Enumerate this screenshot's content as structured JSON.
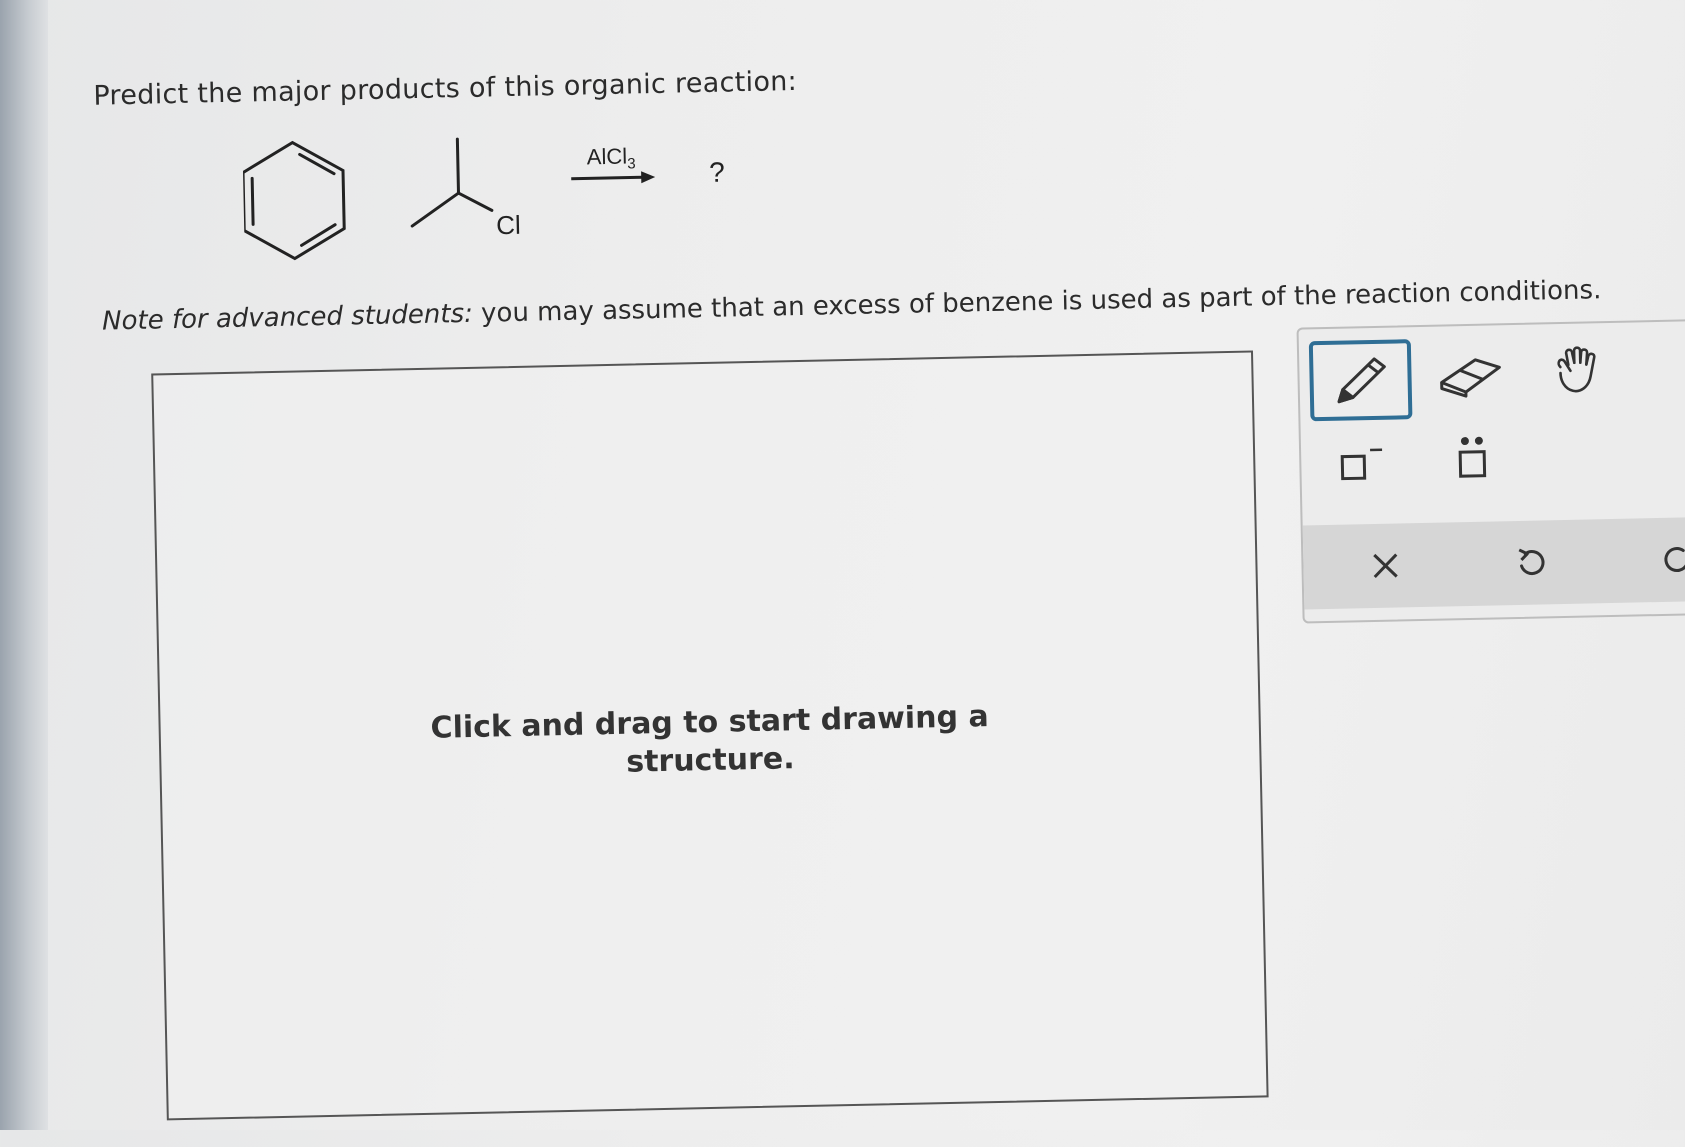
{
  "question": {
    "prompt": "Predict the major products of this organic reaction:",
    "note_italic": "Note for advanced students:",
    "note_rest": " you may assume that an excess of benzene is used as part of the reaction conditions."
  },
  "reaction": {
    "halide_atom": "Cl",
    "reagent": "AlCl",
    "reagent_subscript": "3",
    "product": "?"
  },
  "drawing_canvas": {
    "hint_line1": "Click and drag to start drawing a",
    "hint_line2": "structure."
  },
  "toolbox": {
    "tools": [
      "pencil-icon",
      "eraser-icon",
      "hand-icon",
      "charge-icon",
      "lone-pair-icon"
    ],
    "actions": [
      "close-icon",
      "undo-icon",
      "redo-icon"
    ],
    "selected_tool": "pencil-icon",
    "accent_color": "#2f6e95"
  }
}
